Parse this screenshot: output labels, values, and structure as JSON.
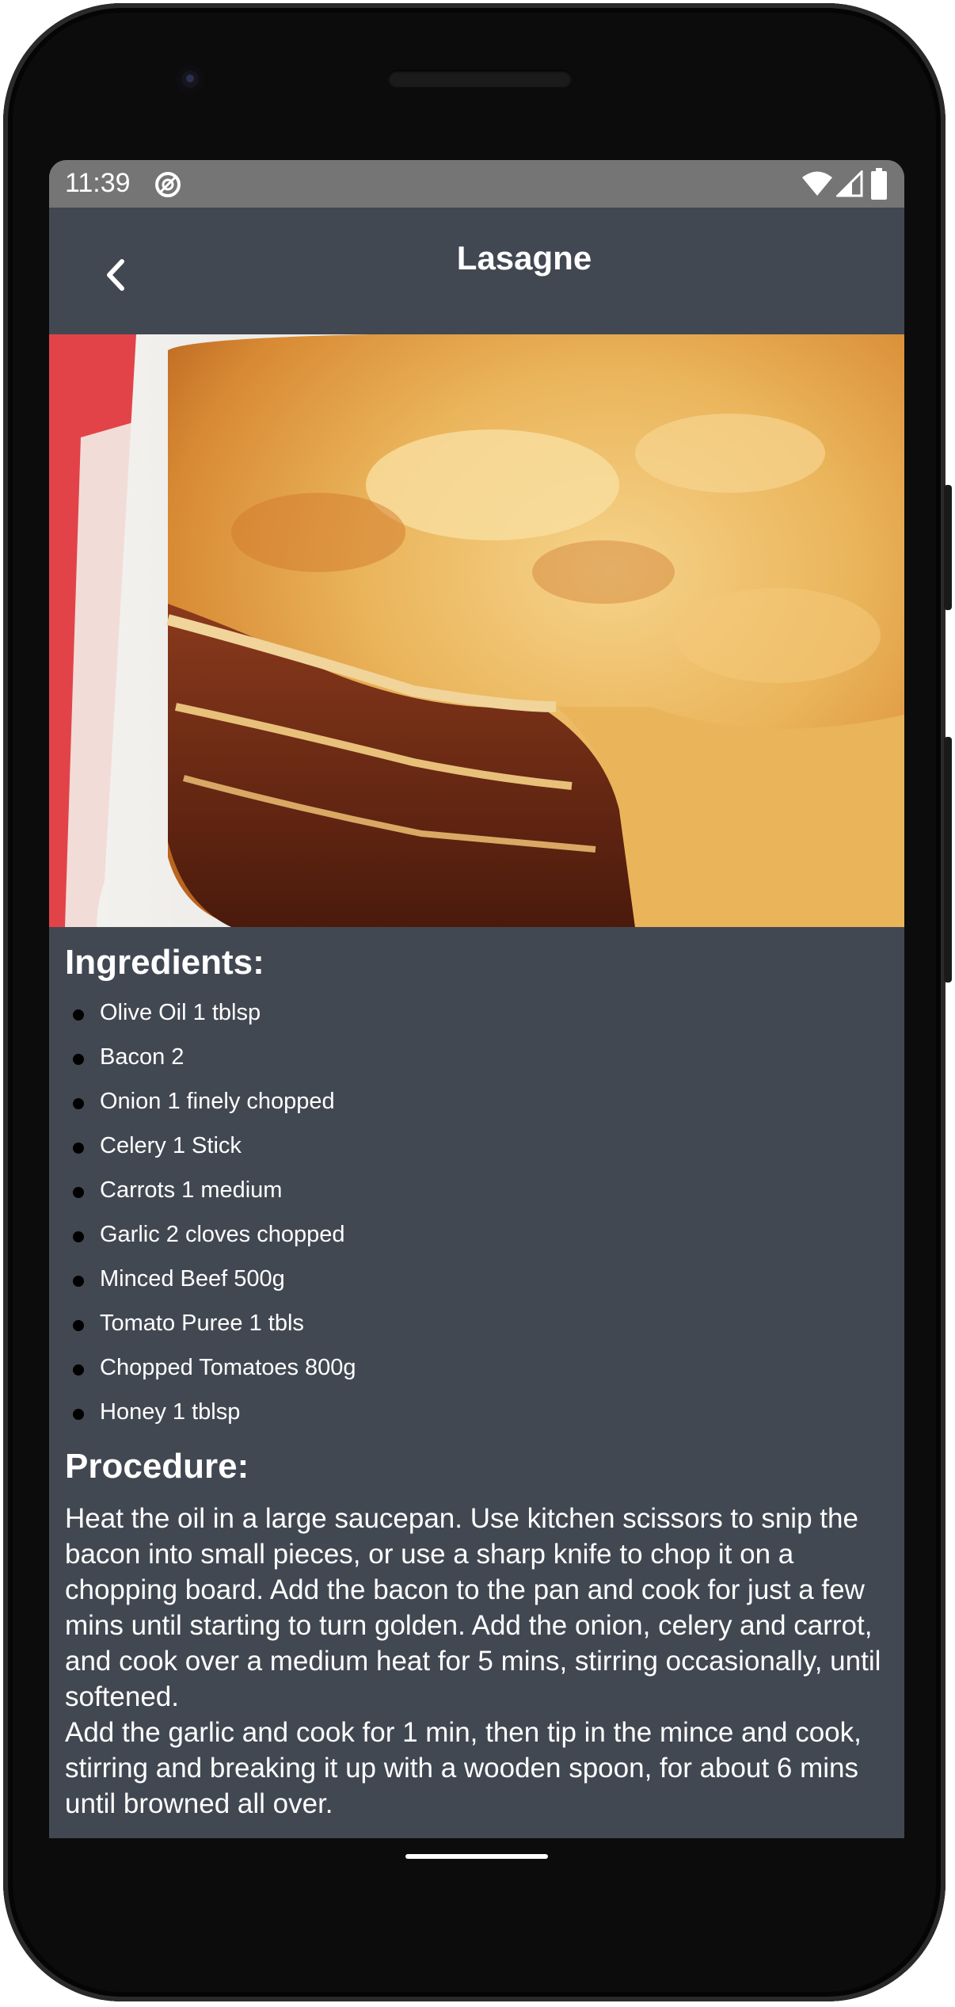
{
  "status_bar": {
    "time": "11:39",
    "icons": [
      "do-not-disturb-icon",
      "wifi-icon",
      "cell-signal-icon",
      "battery-icon"
    ]
  },
  "app_bar": {
    "title": "Lasagne",
    "back_icon": "chevron-left-icon"
  },
  "hero_image": {
    "subject": "lasagne in white baking dish"
  },
  "ingredients": {
    "heading": "Ingredients:",
    "items": [
      "Olive Oil 1 tblsp",
      "Bacon 2",
      "Onion 1 finely chopped",
      "Celery 1 Stick",
      "Carrots 1 medium",
      "Garlic 2 cloves chopped",
      "Minced Beef 500g",
      "Tomato Puree 1 tbls",
      "Chopped Tomatoes 800g",
      "Honey 1 tblsp"
    ]
  },
  "procedure": {
    "heading": "Procedure:",
    "text": "Heat the oil in a large saucepan. Use kitchen scissors to snip the bacon into small pieces, or use a sharp knife to chop it on a chopping board. Add the bacon to the pan and cook for just a few mins until starting to turn golden. Add the onion, celery and carrot, and cook over a medium heat for 5 mins, stirring occasionally, until softened.\nAdd the garlic and cook for 1 min, then tip in the mince and cook, stirring and breaking it up with a wooden spoon, for about 6 mins until browned all over."
  },
  "colors": {
    "background": "#424852",
    "status_bar": "#757575",
    "text": "#ffffff",
    "bullet": "#000000"
  }
}
